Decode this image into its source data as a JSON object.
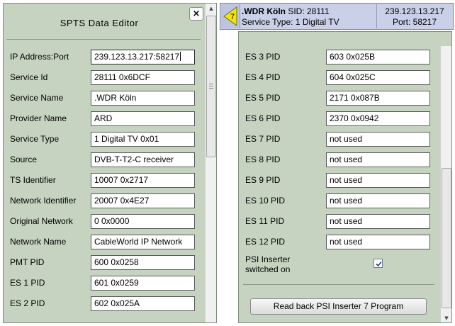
{
  "editor": {
    "title": "SPTS Data Editor",
    "close_label": "×",
    "fields": [
      {
        "label": "IP Address:Port",
        "value": "239.123.13.217:58217"
      },
      {
        "label": "Service Id",
        "value": "28111 0x6DCF"
      },
      {
        "label": "Service Name",
        "value": ".WDR Köln"
      },
      {
        "label": "Provider Name",
        "value": "ARD"
      },
      {
        "label": "Service Type",
        "value": "1 Digital TV 0x01"
      },
      {
        "label": "Source",
        "value": "DVB-T-T2-C receiver"
      },
      {
        "label": "TS Identifier",
        "value": "10007 0x2717"
      },
      {
        "label": "Network Identifier",
        "value": "20007 0x4E27"
      },
      {
        "label": "Original Network",
        "value": "0 0x0000"
      },
      {
        "label": "Network Name",
        "value": "CableWorld IP Network"
      },
      {
        "label": "PMT PID",
        "value": "600 0x0258"
      },
      {
        "label": "ES 1 PID",
        "value": "601 0x0259"
      },
      {
        "label": "ES 2 PID",
        "value": "602 0x025A"
      }
    ]
  },
  "header": {
    "badge": "7",
    "service_name": ".WDR Köln",
    "sid_text": " SID: 28111",
    "service_type": "Service Type: 1 Digital TV",
    "ip": "239.123.13.217",
    "port": "Port: 58217"
  },
  "right": {
    "fields": [
      {
        "label": "ES 3 PID",
        "value": "603 0x025B"
      },
      {
        "label": "ES 4 PID",
        "value": "604 0x025C"
      },
      {
        "label": "ES 5 PID",
        "value": "2171 0x087B"
      },
      {
        "label": "ES 6 PID",
        "value": "2370 0x0942"
      },
      {
        "label": "ES 7 PID",
        "value": "not used"
      },
      {
        "label": "ES 8 PID",
        "value": "not used"
      },
      {
        "label": "ES 9 PID",
        "value": "not used"
      },
      {
        "label": "ES 10 PID",
        "value": "not used"
      },
      {
        "label": "ES 11 PID",
        "value": "not used"
      },
      {
        "label": "ES 12 PID",
        "value": "not used"
      }
    ],
    "psi_label_1": "PSI Inserter",
    "psi_label_2": "switched on",
    "psi_checked": true,
    "read_button": "Read back PSI Inserter 7 Program"
  },
  "colors": {
    "panel_bg": "#c5d3c0",
    "header_bg": "#c9d0e8",
    "badge_yellow": "#f4e400"
  }
}
